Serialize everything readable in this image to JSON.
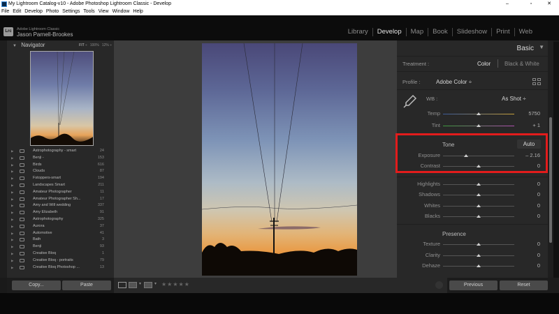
{
  "window": {
    "title": "My Lightroom Catalog-v10 - Adobe Photoshop Lightroom Classic - Develop",
    "minimize": "–",
    "maximize": "▫",
    "close": "✕"
  },
  "menu": [
    "File",
    "Edit",
    "Develop",
    "Photo",
    "Settings",
    "Tools",
    "View",
    "Window",
    "Help"
  ],
  "identity": {
    "logo": "Lrc",
    "product": "Adobe Lightroom Classic",
    "user": "Jason Parnell-Brookes"
  },
  "modules": [
    "Library",
    "Develop",
    "Map",
    "Book",
    "Slideshow",
    "Print",
    "Web"
  ],
  "active_module": "Develop",
  "navigator": {
    "title": "Navigator",
    "zoom": [
      "FIT",
      "100%",
      "12%"
    ]
  },
  "collections": [
    {
      "label": "Astrophotography - smart",
      "count": "24"
    },
    {
      "label": "Benji -",
      "count": "153"
    },
    {
      "label": "Birds",
      "count": "616"
    },
    {
      "label": "Clouds",
      "count": "87"
    },
    {
      "label": "Fstoppers-smart",
      "count": "194"
    },
    {
      "label": "Landscapes Smart",
      "count": "211"
    },
    {
      "label": "Amateur Photographer",
      "count": "11"
    },
    {
      "label": "Amateur Photographer Sh...",
      "count": "17"
    },
    {
      "label": "Amy and Will wedding",
      "count": "337"
    },
    {
      "label": "Amy Elizabeth",
      "count": "91"
    },
    {
      "label": "Astrophotography",
      "count": "325"
    },
    {
      "label": "Aurora",
      "count": "37"
    },
    {
      "label": "Automotive",
      "count": "41"
    },
    {
      "label": "Bath",
      "count": "3"
    },
    {
      "label": "Benji",
      "count": "93"
    },
    {
      "label": "Creative Bloq",
      "count": "1"
    },
    {
      "label": "Creative Bloq - portraits",
      "count": "79"
    },
    {
      "label": "Creative Bloq Photoshop ...",
      "count": "13"
    }
  ],
  "left_buttons": {
    "copy": "Copy...",
    "paste": "Paste"
  },
  "toolbar": {
    "stars": "★★★★★"
  },
  "basic": {
    "title": "Basic",
    "treatment_label": "Treatment :",
    "treatment_color": "Color",
    "treatment_bw": "Black & White",
    "profile_label": "Profile :",
    "profile_value": "Adobe Color ÷",
    "wb_label": "WB :",
    "wb_value": "As Shot ÷",
    "tone_label": "Tone",
    "auto_label": "Auto",
    "presence_label": "Presence"
  },
  "sliders": [
    {
      "label": "Temp",
      "value": "5750",
      "pos": 0.5
    },
    {
      "label": "Tint",
      "value": "+ 1",
      "pos": 0.5
    },
    {
      "label": "Exposure",
      "value": "– 2.16",
      "pos": 0.32
    },
    {
      "label": "Contrast",
      "value": "0",
      "pos": 0.5
    },
    {
      "label": "Highlights",
      "value": "0",
      "pos": 0.5
    },
    {
      "label": "Shadows",
      "value": "0",
      "pos": 0.5
    },
    {
      "label": "Whites",
      "value": "0",
      "pos": 0.5
    },
    {
      "label": "Blacks",
      "value": "0",
      "pos": 0.5
    },
    {
      "label": "Texture",
      "value": "0",
      "pos": 0.5
    },
    {
      "label": "Clarity",
      "value": "0",
      "pos": 0.5
    },
    {
      "label": "Dehaze",
      "value": "0",
      "pos": 0.5
    }
  ],
  "right_buttons": {
    "previous": "Previous",
    "reset": "Reset"
  },
  "colors": {
    "accent_highlight": "#e21c1c",
    "active_text": "#e4e4e4"
  }
}
